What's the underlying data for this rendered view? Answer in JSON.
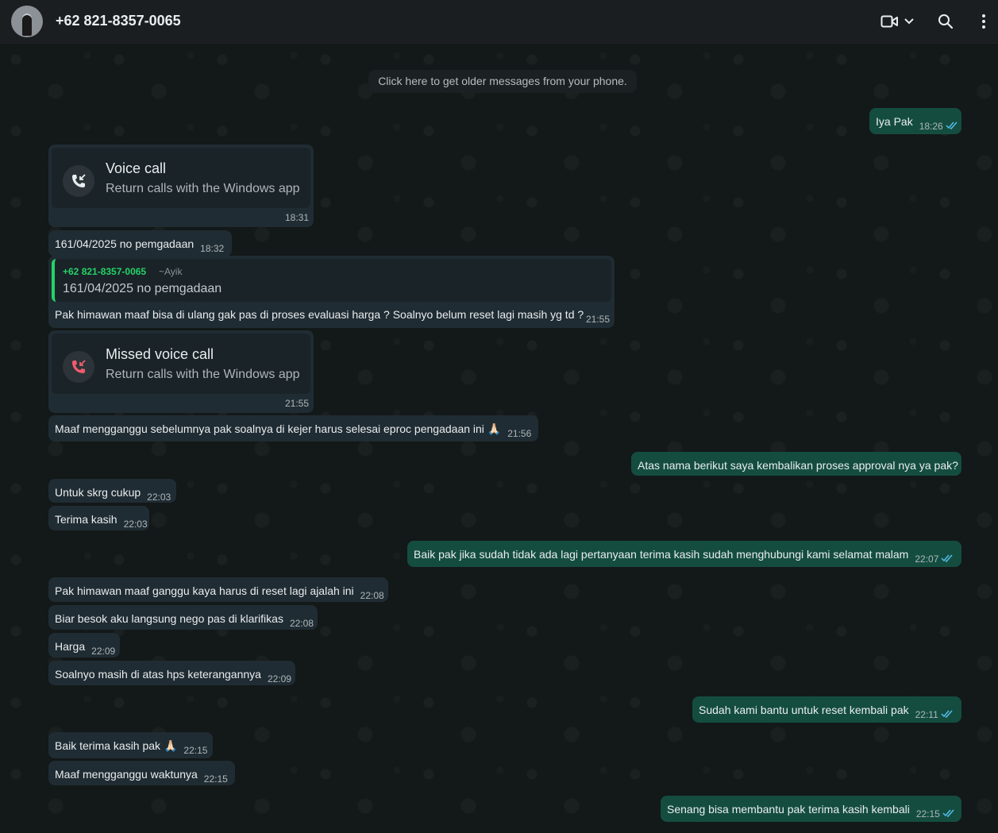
{
  "header": {
    "title": "+62 821-8357-0065",
    "icons": [
      "video-call-icon",
      "chevron-down-icon",
      "search-icon",
      "more-options-icon"
    ]
  },
  "system": {
    "older_messages": "Click here to get older messages from your phone."
  },
  "calls": [
    {
      "title": "Voice call",
      "subtitle": "Return calls with the Windows app",
      "time": "18:31"
    },
    {
      "title": "Missed voice call",
      "subtitle": "Return calls with the Windows app",
      "time": "21:55"
    }
  ],
  "quote": {
    "name": "+62 821-8357-0065",
    "alias": "~Ayik",
    "text": "161/04/2025 no pemgadaan",
    "body": "Pak himawan maaf bisa di ulang gak pas di proses evaluasi harga ? Soalnyo belum reset lagi masih yg td ?",
    "time": "21:55"
  },
  "messages": [
    {
      "dir": "out",
      "text": "Iya Pak",
      "time": "18:26"
    },
    {
      "dir": "in",
      "text": "161/04/2025 no pemgadaan",
      "time": "18:32"
    },
    {
      "dir": "in",
      "text": "Maaf mengganggu sebelumnya pak soalnya di kejer harus selesai eproc pengadaan ini 🙏🏻",
      "time": "21:56"
    },
    {
      "dir": "out",
      "text": "Atas nama berikut saya kembalikan proses approval nya ya pak?",
      "time": ""
    },
    {
      "dir": "in",
      "text": "Untuk skrg cukup",
      "time": "22:03"
    },
    {
      "dir": "in",
      "text": "Terima kasih",
      "time": "22:03"
    },
    {
      "dir": "out",
      "text": "Baik pak jika sudah tidak ada lagi pertanyaan terima kasih sudah menghubungi kami selamat malam",
      "time": "22:07"
    },
    {
      "dir": "in",
      "text": "Pak himawan maaf ganggu kaya harus di reset lagi ajalah ini",
      "time": "22:08"
    },
    {
      "dir": "in",
      "text": "Biar besok aku langsung nego pas di klarifikas",
      "time": "22:08"
    },
    {
      "dir": "in",
      "text": "Harga",
      "time": "22:09"
    },
    {
      "dir": "in",
      "text": "Soalnyo masih di atas hps keterangannya",
      "time": "22:09"
    },
    {
      "dir": "out",
      "text": "Sudah kami bantu untuk reset kembali pak",
      "time": "22:11"
    },
    {
      "dir": "in",
      "text": "Baik terima kasih pak 🙏🏻",
      "time": "22:15"
    },
    {
      "dir": "in",
      "text": "Maaf mengganggu waktunya",
      "time": "22:15"
    },
    {
      "dir": "out",
      "text": "Senang bisa membantu pak terima kasih kembali",
      "time": "22:15"
    }
  ],
  "colors": {
    "incoming": "#202c33",
    "outgoing": "#144d40",
    "accent": "#25d366",
    "read_ticks": "#53bdeb"
  }
}
